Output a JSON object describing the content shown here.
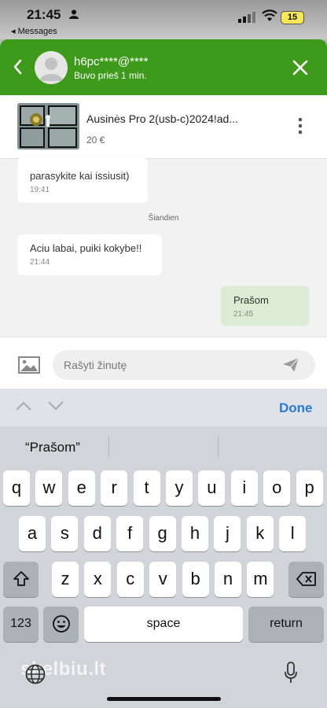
{
  "status_bar": {
    "time": "21:45",
    "back_app": "◂ Messages",
    "battery": "15"
  },
  "header": {
    "contact_name": "h6pc****@****",
    "last_seen": "Buvo prieš 1 min."
  },
  "listing": {
    "title": "Ausinės Pro 2(usb-c)2024!ad...",
    "price": "20 €"
  },
  "messages": [
    {
      "text": "parasykite kai issiusit)",
      "time": "19:41",
      "direction": "incoming"
    },
    {
      "text": "Aciu labai, puiki kokybe!!",
      "time": "21:44",
      "direction": "incoming"
    },
    {
      "text": "Prašom",
      "time": "21:45",
      "direction": "outgoing"
    }
  ],
  "day_separator": "Šiandien",
  "composer": {
    "placeholder": "Rašyti žinutę"
  },
  "accessory": {
    "done_label": "Done"
  },
  "keyboard": {
    "suggestion": "“Prašom”",
    "row1": [
      "q",
      "w",
      "e",
      "r",
      "t",
      "y",
      "u",
      "i",
      "o",
      "p"
    ],
    "row2": [
      "a",
      "s",
      "d",
      "f",
      "g",
      "h",
      "j",
      "k",
      "l"
    ],
    "row3": [
      "z",
      "x",
      "c",
      "v",
      "b",
      "n",
      "m"
    ],
    "numbers_label": "123",
    "space_label": "space",
    "return_label": "return"
  },
  "watermark": "skelbiu.lt",
  "colors": {
    "header_green": "#3d9a1b",
    "outgoing_bubble": "#dcebd4",
    "done_blue": "#2a79d4"
  }
}
